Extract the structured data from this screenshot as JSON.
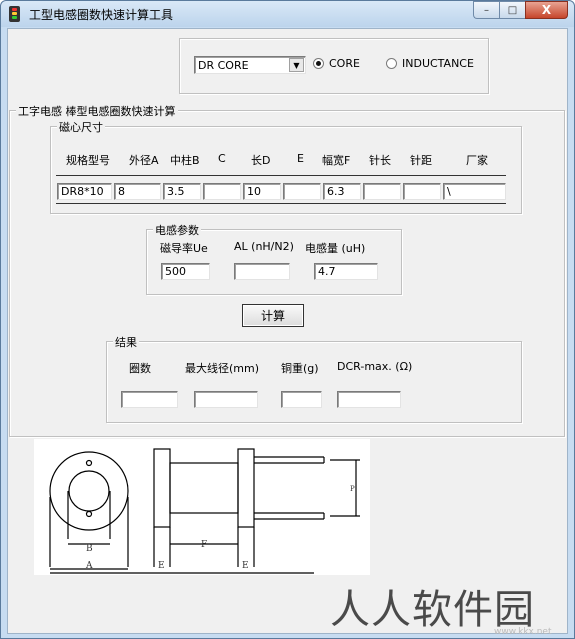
{
  "window": {
    "title": "工型电感圈数快速计算工具",
    "caption_min": "–",
    "caption_max": "□",
    "caption_close": "X"
  },
  "mode": {
    "core_type_selected": "DR CORE",
    "radio_core_label": "CORE",
    "radio_inductance_label": "INDUCTANCE",
    "radio_core_selected": true
  },
  "core_group": {
    "title": "工字电感 棒型电感圈数快速计算"
  },
  "dimensions": {
    "title": "磁心尺寸",
    "headers": [
      "规格型号",
      "外径A",
      "中柱B",
      "C",
      "长D",
      "E",
      "幅宽F",
      "针长",
      "针距",
      "厂家"
    ],
    "values": [
      "DR8*10",
      "8",
      "3.5",
      "",
      "10",
      "",
      "6.3",
      "",
      "",
      "\\"
    ]
  },
  "inductance_params": {
    "title": "电感参数",
    "labels": [
      "磁导率Ue",
      "AL (nH/N2)",
      "电感量 (uH)"
    ],
    "values": [
      "500",
      "",
      "4.7"
    ]
  },
  "calc_button": "计算",
  "results": {
    "title": "结果",
    "labels": [
      "圈数",
      "最大线径(mm)",
      "铜重(g)",
      "DCR-max. (Ω)"
    ],
    "values": [
      "",
      "",
      "",
      ""
    ]
  },
  "diagram_labels": {
    "b": "B",
    "a": "A",
    "f": "F",
    "e1": "E",
    "e2": "E",
    "p": "P"
  },
  "watermark": {
    "text": "人人软件园",
    "sub": "www.kkx.net"
  }
}
